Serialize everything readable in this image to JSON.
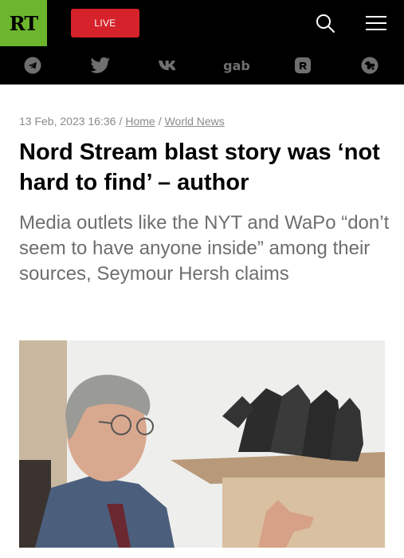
{
  "header": {
    "logo_text": "RT",
    "live_label": "LIVE",
    "icons": [
      "search-icon",
      "menu-icon"
    ]
  },
  "social": {
    "icons": [
      "telegram-icon",
      "twitter-icon",
      "vk-icon",
      "gab-icon",
      "rumble-icon",
      "odysee-icon"
    ],
    "gab_label": "gab"
  },
  "article": {
    "date": "13 Feb, 2023 16:36",
    "breadcrumb": [
      "Home",
      "World News"
    ],
    "separator": "/",
    "title": "Nord Stream blast story was ‘not hard to find’ – author",
    "summary": "Media outlets like the NYT and WaPo “don’t seem to have anyone inside” among their sources, Seymour Hersh claims"
  },
  "colors": {
    "logo_green": "#6cb52d",
    "live_red": "#d6222a",
    "bar_black": "#000000",
    "meta_gray": "#8a8a8a",
    "summary_gray": "#6e6e6e"
  }
}
